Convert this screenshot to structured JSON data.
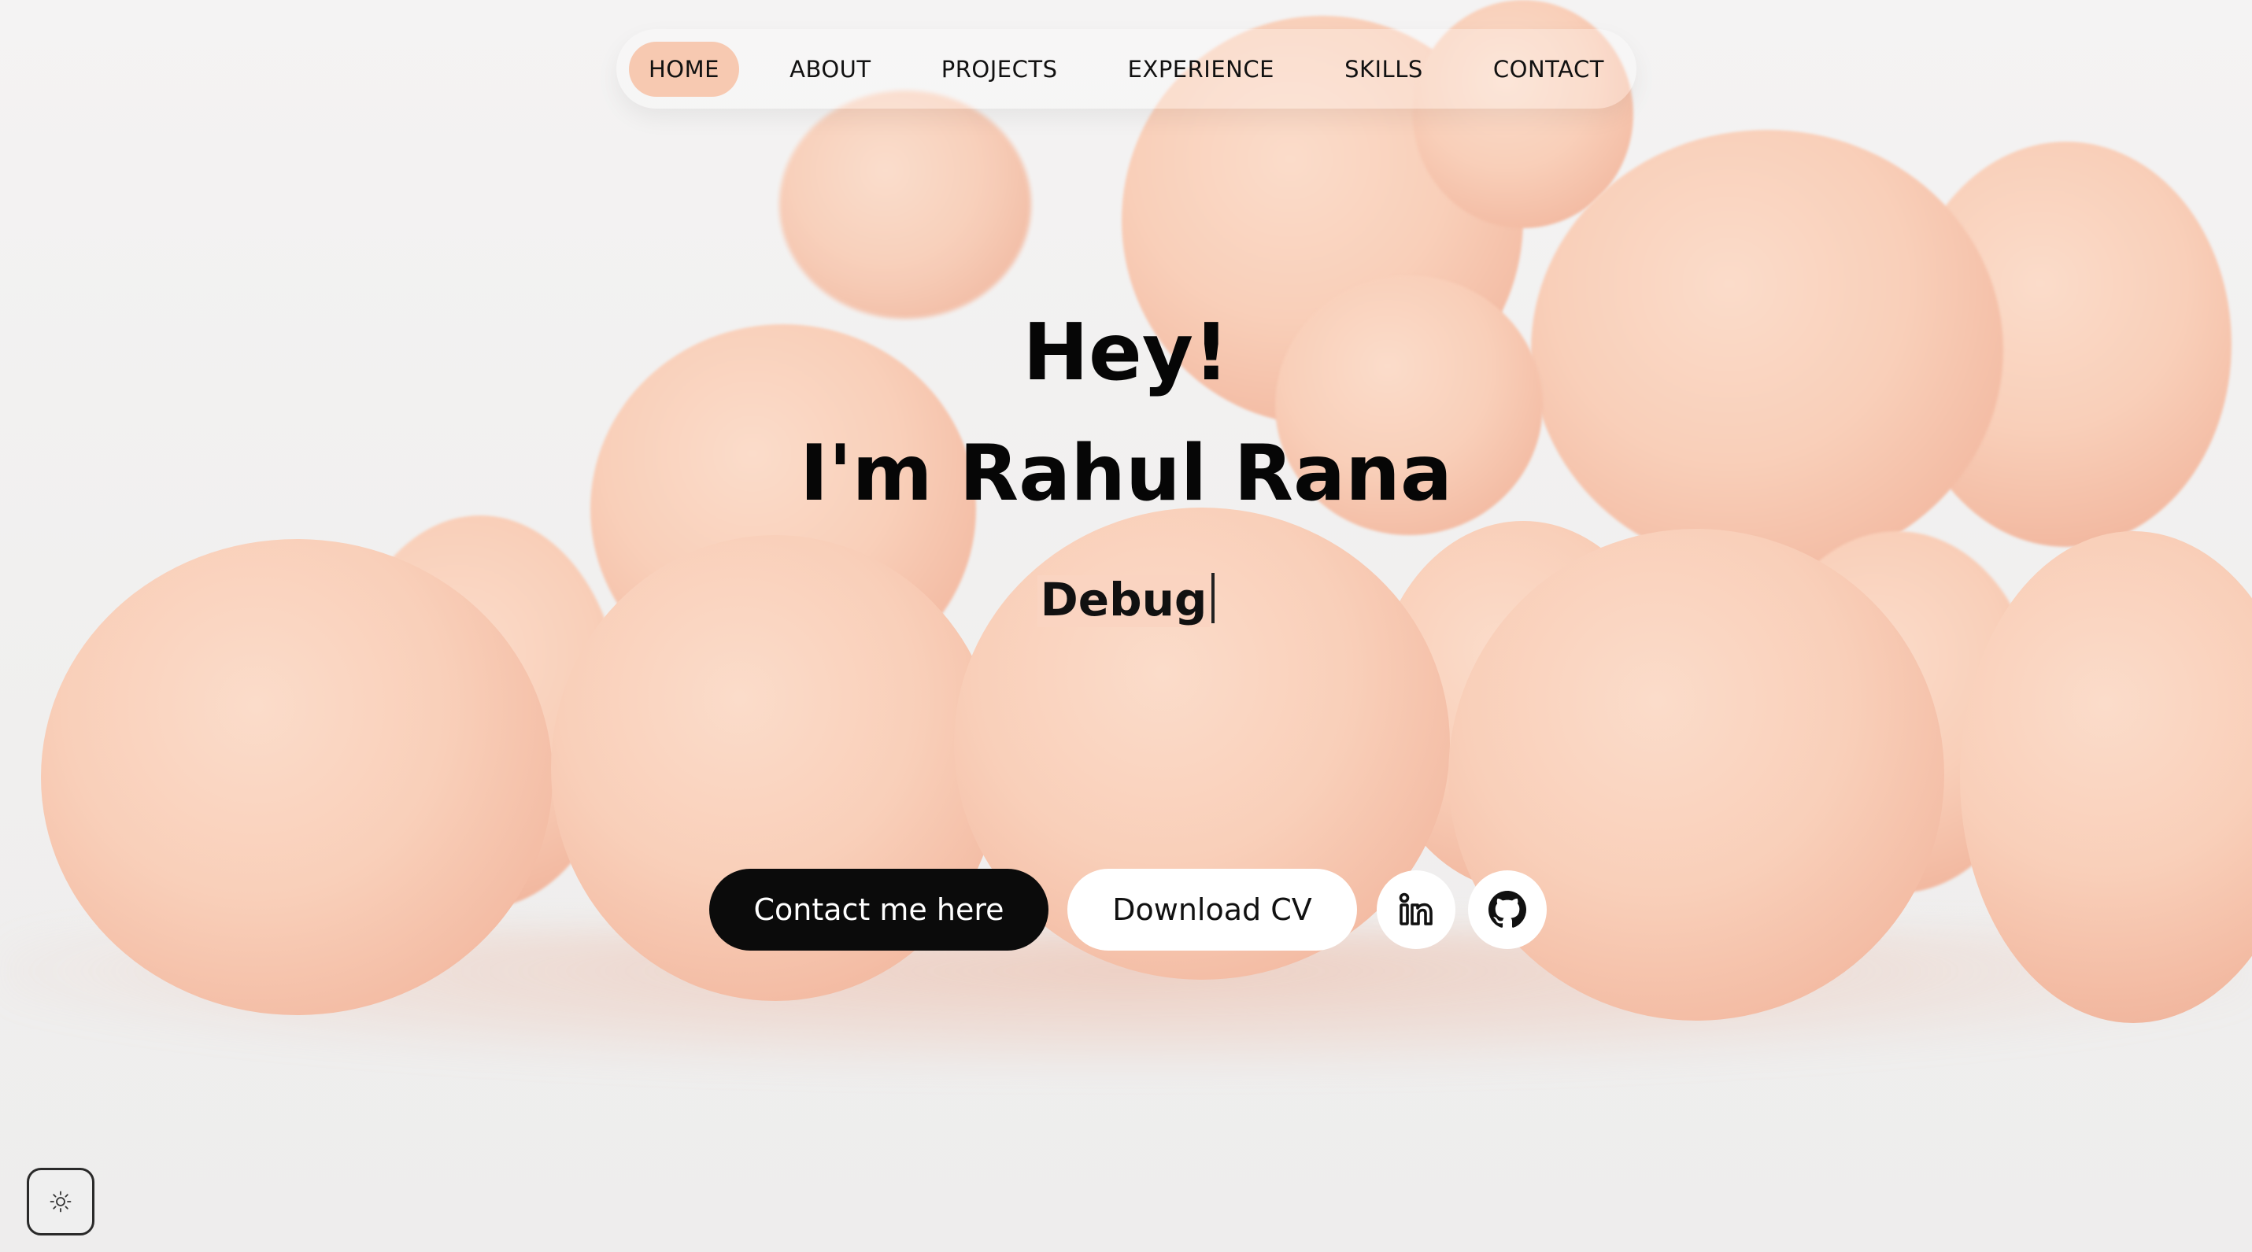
{
  "nav": {
    "items": [
      {
        "label": "HOME",
        "active": true
      },
      {
        "label": "ABOUT",
        "active": false
      },
      {
        "label": "PROJECTS",
        "active": false
      },
      {
        "label": "EXPERIENCE",
        "active": false
      },
      {
        "label": "SKILLS",
        "active": false
      },
      {
        "label": "CONTACT",
        "active": false
      }
    ]
  },
  "hero": {
    "greeting": "Hey!",
    "name": "I'm Rahul Rana",
    "typed_text": "Debug"
  },
  "actions": {
    "contact_label": "Contact me here",
    "cv_label": "Download CV",
    "linkedin_icon": "linkedin-icon",
    "github_icon": "github-icon"
  },
  "theme_toggle": {
    "icon": "sun-icon"
  },
  "colors": {
    "accent": "#f7c9b1",
    "sphere": "#f9cfb9",
    "primary_button": "#0b0b0b",
    "text": "#060606",
    "background": "#f1f1f1"
  }
}
